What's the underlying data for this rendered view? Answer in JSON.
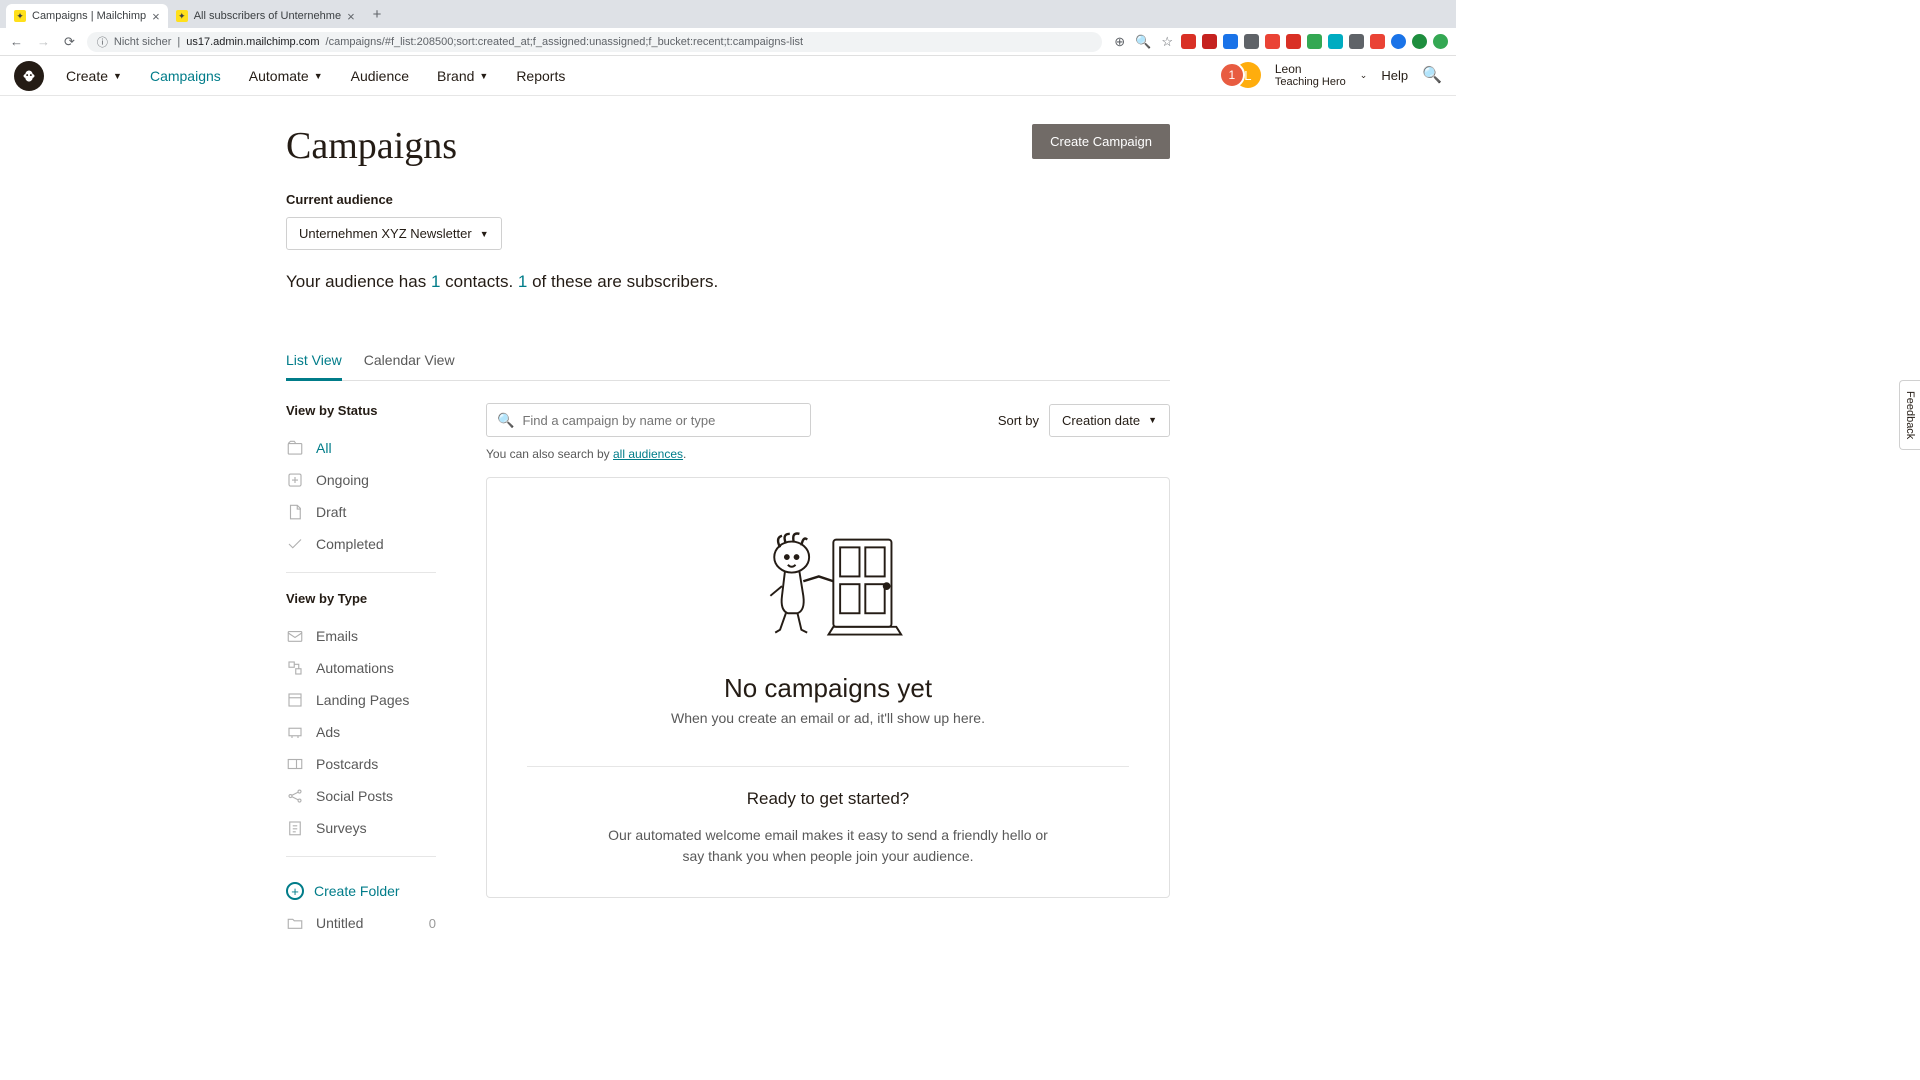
{
  "browser": {
    "tabs": [
      {
        "title": "Campaigns | Mailchimp",
        "active": true
      },
      {
        "title": "All subscribers of Unternehme",
        "active": false
      }
    ],
    "url_insecure": "Nicht sicher",
    "url_host": "us17.admin.mailchimp.com",
    "url_path": "/campaigns/#f_list:208500;sort:created_at;f_assigned:unassigned;f_bucket:recent;t:campaigns-list"
  },
  "nav": {
    "items": [
      "Create",
      "Campaigns",
      "Automate",
      "Audience",
      "Brand",
      "Reports"
    ],
    "active_index": 1,
    "notification_count": "1",
    "avatar_initial": "L",
    "user_name": "Leon",
    "user_org": "Teaching Hero",
    "help": "Help"
  },
  "page": {
    "title": "Campaigns",
    "create_button": "Create Campaign",
    "audience_label": "Current audience",
    "audience_selected": "Unternehmen XYZ Newsletter",
    "stats_prefix": "Your audience has ",
    "stats_contacts": "1",
    "stats_mid": " contacts. ",
    "stats_subs": "1",
    "stats_suffix": " of these are subscribers."
  },
  "tabs": {
    "list": "List View",
    "calendar": "Calendar View"
  },
  "sidebar": {
    "status_heading": "View by Status",
    "status_items": [
      "All",
      "Ongoing",
      "Draft",
      "Completed"
    ],
    "type_heading": "View by Type",
    "type_items": [
      "Emails",
      "Automations",
      "Landing Pages",
      "Ads",
      "Postcards",
      "Social Posts",
      "Surveys"
    ],
    "create_folder": "Create Folder",
    "folder_name": "Untitled",
    "folder_count": "0"
  },
  "search": {
    "placeholder": "Find a campaign by name or type",
    "hint_prefix": "You can also search by ",
    "hint_link": "all audiences",
    "hint_suffix": ".",
    "sort_label": "Sort by",
    "sort_value": "Creation date"
  },
  "empty": {
    "title": "No campaigns yet",
    "sub": "When you create an email or ad, it'll show up here.",
    "ready_title": "Ready to get started?",
    "ready_text": "Our automated welcome email makes it easy to send a friendly hello or say thank you when people join your audience."
  },
  "feedback": "Feedback"
}
